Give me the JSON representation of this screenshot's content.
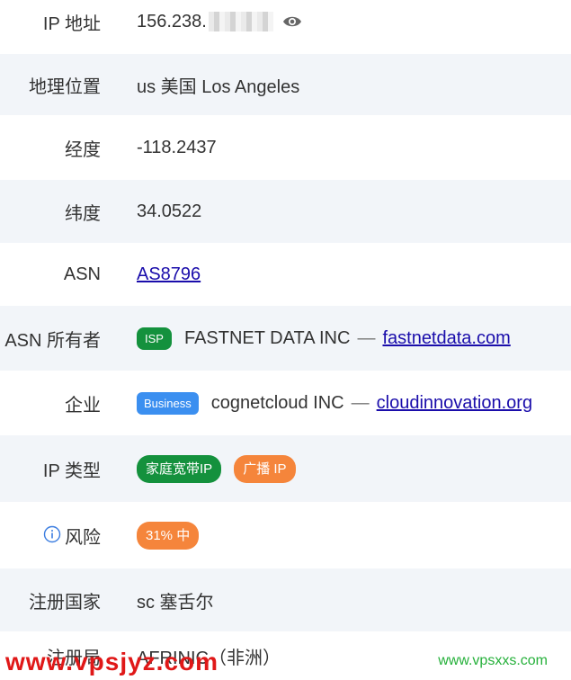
{
  "rows": {
    "ip": {
      "label": "IP 地址",
      "value": "156.238."
    },
    "geo": {
      "label": "地理位置",
      "value": "us 美国 Los Angeles"
    },
    "lon": {
      "label": "经度",
      "value": "-118.2437"
    },
    "lat": {
      "label": "纬度",
      "value": "34.0522"
    },
    "asn": {
      "label": "ASN",
      "value": "AS8796"
    },
    "asn_owner": {
      "label": "ASN 所有者",
      "badge": "ISP",
      "name": "FASTNET DATA INC",
      "sep": "—",
      "domain": "fastnetdata.com"
    },
    "company": {
      "label": "企业",
      "badge": "Business",
      "name": "cognetcloud INC",
      "sep": "—",
      "domain": "cloudinnovation.org"
    },
    "ip_type": {
      "label": "IP 类型",
      "badges": [
        "家庭宽带IP",
        "广播 IP"
      ]
    },
    "risk": {
      "label": "风险",
      "badge": "31% 中"
    },
    "country": {
      "label": "注册国家",
      "value": "sc 塞舌尔"
    },
    "registry": {
      "label": "注册局",
      "value": "AFRINIC（非洲）"
    }
  },
  "watermarks": {
    "left": "www.vpsjyz.com",
    "right": "www.vpsxxs.com"
  },
  "colors": {
    "link": "#1a0dab",
    "green": "#14913d",
    "blue": "#3b8ff0",
    "orange": "#f5853b",
    "row_alt": "#f2f5f9"
  },
  "icons": {
    "eye": "eye-icon",
    "info": "info-circle-icon"
  }
}
